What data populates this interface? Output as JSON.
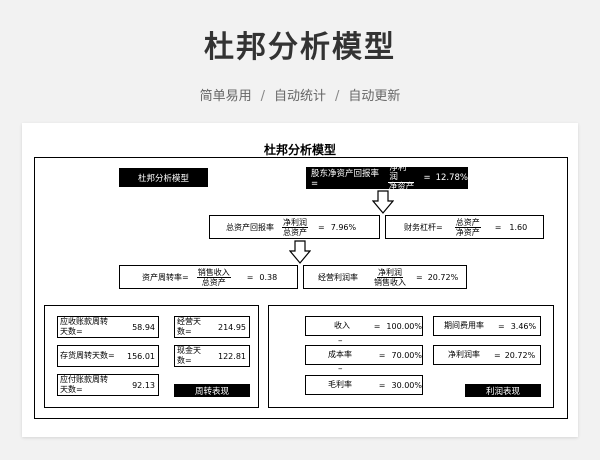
{
  "hero": {
    "title": "杜邦分析模型",
    "subtitle_1": "简单易用",
    "subtitle_2": "自动统计",
    "subtitle_3": "自动更新",
    "separator": "/"
  },
  "sheet": {
    "title": "杜邦分析模型",
    "header_label": "杜邦分析模型",
    "roe": {
      "label": "股东净资产回报率=",
      "num": "净利润",
      "den": "净资产",
      "eq": "=",
      "value": "12.78%"
    },
    "roa": {
      "label": "总资产回报率",
      "num": "净利润",
      "den": "总资产",
      "eq": "=",
      "value": "7.96%"
    },
    "leverage": {
      "label": "财务杠杆=",
      "num": "总资产",
      "den": "净资产",
      "eq": "=",
      "value": "1.60"
    },
    "turnover": {
      "label": "资产周转率=",
      "num": "销售收入",
      "den": "总资产",
      "eq": "=",
      "value": "0.38"
    },
    "margin": {
      "label": "经营利润率",
      "num": "净利润",
      "den": "销售收入",
      "eq": "=",
      "value": "20.72%"
    },
    "left_panel": {
      "receivable_days": {
        "label_1": "应收账款周转",
        "label_2": "天数=",
        "value": "58.94"
      },
      "inventory_days": {
        "label": "存货周转天数=",
        "value": "156.01"
      },
      "payable_days": {
        "label_1": "应付账款周转",
        "label_2": "天数=",
        "value": "92.13"
      },
      "operating_days": {
        "label_1": "经营天",
        "label_2": "数=",
        "value": "214.95"
      },
      "cash_days": {
        "label_1": "现金天",
        "label_2": "数=",
        "value": "122.81"
      },
      "caption": "周转表现"
    },
    "right_panel": {
      "revenue": {
        "label": "收入",
        "eq": "=",
        "value": "100.00%"
      },
      "cost": {
        "label": "成本率",
        "eq": "=",
        "value": "70.00%"
      },
      "gross": {
        "label": "毛利率",
        "eq": "=",
        "value": "30.00%"
      },
      "minus_1": "–",
      "minus_2": "–",
      "expense": {
        "label": "期间费用率",
        "eq": "=",
        "value": "3.46%"
      },
      "net": {
        "label": "净利润率",
        "eq": "=",
        "value": "20.72%"
      },
      "caption": "利润表现"
    }
  }
}
